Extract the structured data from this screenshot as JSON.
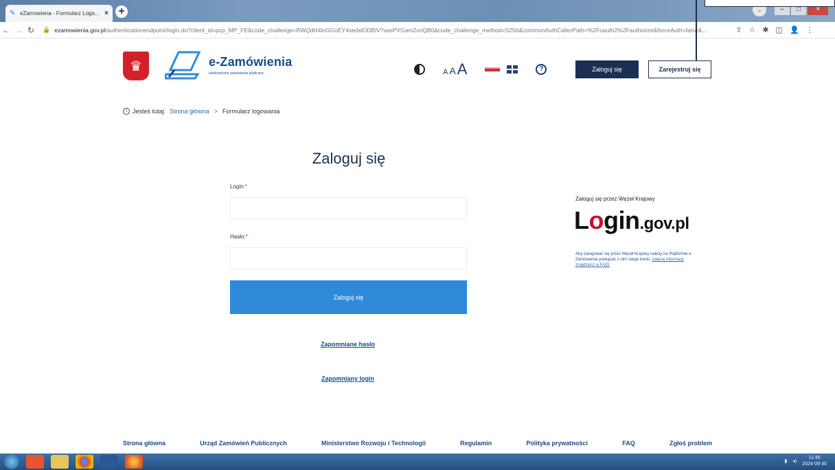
{
  "browser": {
    "tab_title": "eZamowiena - Formularz Logo...",
    "tab_close": "×",
    "new_tab": "+",
    "url_host": "ezamowienia.gov.pl",
    "url_path": "/authenticationendpoint/login.do?client_id=pzp_MP_FE&code_challenge=RWQdH4lnGGoEY4sedxlODBlV?vasPVGam2voQB0&code_challenge_method=S256&commonAuthCallerPath=%2Foauth2%2Fauthorize&forceAuth=false&..."
  },
  "header": {
    "brand_name": "e-Zamówienia",
    "brand_sub": "elektroniczne zamówienia publiczne",
    "font_small": "A",
    "font_medium": "A",
    "font_large": "A",
    "login_button": "Zaloguj się",
    "register_button": "Zarejestruj się"
  },
  "breadcrumb": {
    "prefix": "Jesteś tutaj:",
    "home": "Strona główna",
    "separator": ">",
    "current": "Formularz logowania"
  },
  "form": {
    "title": "Zaloguj się",
    "login_label": "Login:",
    "password_label": "Hasło:",
    "required_mark": "*",
    "login_value": "",
    "password_value": "",
    "submit": "Zaloguj się",
    "forgot_password": "Zapomniane hasło",
    "forgot_login": "Zapomniany login"
  },
  "login_gov": {
    "title": "Zaloguj się przez Węzeł Krajowy",
    "logo_l": "L",
    "logo_o": "o",
    "logo_gin": "gin",
    "logo_domain": ".gov.pl",
    "description": "Aby zalogować się przez Węzeł Krajowy należy na Platformie e-Zamówienia powiązać z nim swoje konto.",
    "more": "(więcej informacji znajdziesz w FAQ)"
  },
  "footer": {
    "links": [
      "Strona główna",
      "Urząd Zamówień Publicznych",
      "Ministerstwo Rozwoju i Technologii",
      "Regulamin",
      "Polityka prywatności",
      "FAQ",
      "Zgłoś problem"
    ]
  },
  "taskbar": {
    "time": "11:45",
    "date": "2024-09-30"
  }
}
